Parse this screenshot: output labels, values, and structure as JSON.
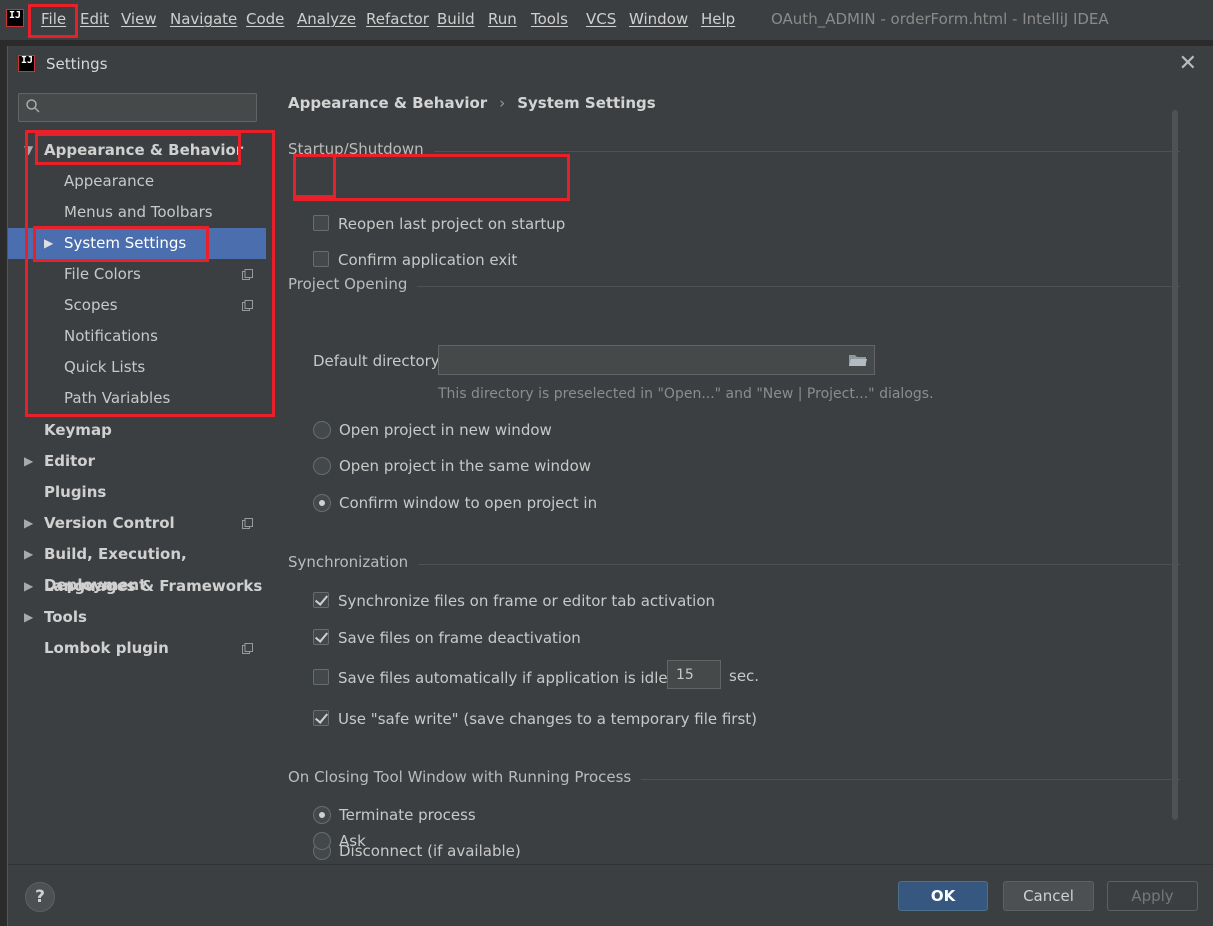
{
  "menubar": {
    "logo_text": "IJ",
    "items": [
      "File",
      "Edit",
      "View",
      "Navigate",
      "Code",
      "Analyze",
      "Refactor",
      "Build",
      "Run",
      "Tools",
      "VCS",
      "Window",
      "Help"
    ],
    "window_title": "OAuth_ADMIN - orderForm.html - IntelliJ IDEA"
  },
  "dialog": {
    "title": "Settings",
    "logo_text": "IJ",
    "close_glyph": "✕"
  },
  "sidebar": {
    "search_placeholder": "",
    "items": [
      {
        "label": "Appearance & Behavior",
        "bold": true,
        "arrow": "▼"
      },
      {
        "label": "Appearance"
      },
      {
        "label": "Menus and Toolbars"
      },
      {
        "label": "System Settings",
        "arrow": "▶",
        "selected": true
      },
      {
        "label": "File Colors",
        "config": true
      },
      {
        "label": "Scopes",
        "config": true
      },
      {
        "label": "Notifications"
      },
      {
        "label": "Quick Lists"
      },
      {
        "label": "Path Variables"
      },
      {
        "label": "Keymap",
        "bold": true
      },
      {
        "label": "Editor",
        "bold": true,
        "arrow": "▶"
      },
      {
        "label": "Plugins",
        "bold": true
      },
      {
        "label": "Version Control",
        "bold": true,
        "arrow": "▶",
        "config": true
      },
      {
        "label": "Build, Execution, Deployment",
        "bold": true,
        "arrow": "▶"
      },
      {
        "label": "Languages & Frameworks",
        "bold": true,
        "arrow": "▶"
      },
      {
        "label": "Tools",
        "bold": true,
        "arrow": "▶"
      },
      {
        "label": "Lombok plugin",
        "bold": true,
        "config": true
      }
    ]
  },
  "content": {
    "breadcrumb": [
      "Appearance & Behavior",
      "System Settings"
    ],
    "breadcrumb_sep": "›",
    "startup": {
      "title": "Startup/Shutdown",
      "reopen_label": "Reopen last project on startup",
      "reopen_checked": false,
      "confirm_exit_label": "Confirm application exit",
      "confirm_exit_checked": false
    },
    "project_opening": {
      "title": "Project Opening",
      "default_dir_label": "Default directory:",
      "default_dir_value": "",
      "hint": "This directory is preselected in \"Open...\" and \"New | Project...\" dialogs.",
      "radio_new_window": "Open project in new window",
      "radio_same_window": "Open project in the same window",
      "radio_confirm": "Confirm window to open project in",
      "selected": "confirm"
    },
    "sync": {
      "title": "Synchronization",
      "sync_files_label": "Synchronize files on frame or editor tab activation",
      "sync_files_checked": true,
      "save_deactivation_label": "Save files on frame deactivation",
      "save_deactivation_checked": true,
      "save_idle_label": "Save files automatically if application is idle for",
      "save_idle_checked": false,
      "idle_seconds": "15",
      "idle_unit": "sec.",
      "safe_write_label": "Use \"safe write\" (save changes to a temporary file first)",
      "safe_write_checked": true
    },
    "closing": {
      "title": "On Closing Tool Window with Running Process",
      "radio_terminate": "Terminate process",
      "radio_disconnect": "Disconnect (if available)",
      "radio_ask": "Ask",
      "selected": "terminate"
    }
  },
  "footer": {
    "help_label": "?",
    "ok_label": "OK",
    "cancel_label": "Cancel",
    "apply_label": "Apply"
  },
  "colors": {
    "selection": "#4b6eaf",
    "highlight": "#e8202a",
    "primary_button": "#365880"
  }
}
